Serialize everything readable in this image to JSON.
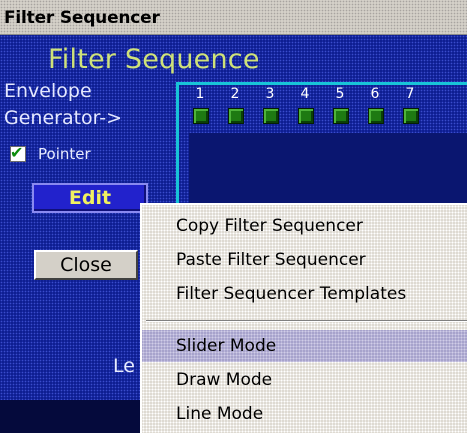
{
  "window": {
    "title": "Filter Sequencer"
  },
  "panel": {
    "heading": "Filter Sequence",
    "envelope_line1": "Envelope",
    "envelope_line2": "Generator->",
    "pointer_label": "Pointer",
    "pointer_checked": true,
    "edit_label": "Edit",
    "close_label": "Close",
    "partial_label": "Le",
    "step_numbers": [
      "1",
      "2",
      "3",
      "4",
      "5",
      "6",
      "7"
    ]
  },
  "context_menu": {
    "items": [
      {
        "label": "Copy Filter Sequencer"
      },
      {
        "label": "Paste  Filter Sequencer"
      },
      {
        "label": "Filter Sequencer Templates"
      },
      {
        "label": "Slider Mode",
        "highlighted": true
      },
      {
        "label": "Draw Mode"
      },
      {
        "label": "Line Mode"
      }
    ]
  },
  "colors": {
    "panel_bg": "#0e1e92",
    "heading": "#cfe27a",
    "edit_text": "#f0f060",
    "grid_border": "#18c4d8",
    "led_green": "#1e7a12"
  }
}
